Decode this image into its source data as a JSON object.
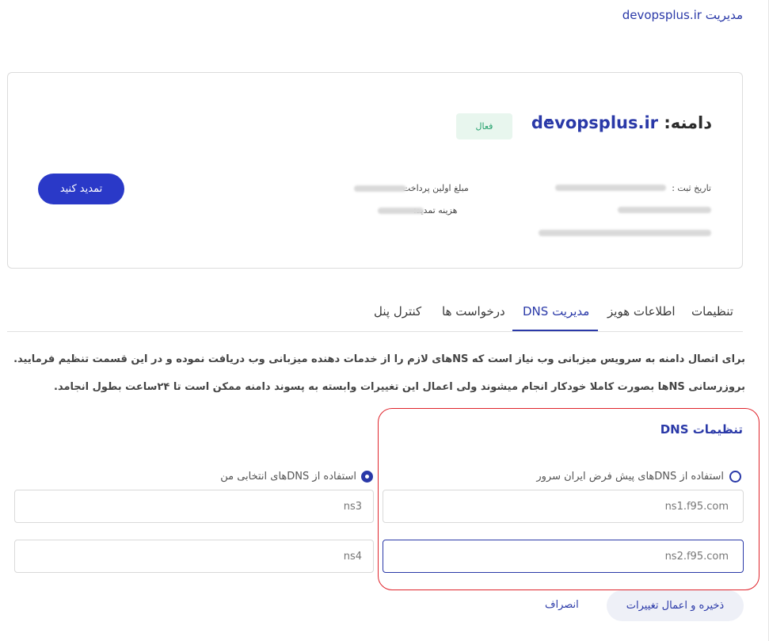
{
  "breadcrumb": {
    "prefix": "مدیریت",
    "domain": "devopsplus.ir"
  },
  "domain_card": {
    "label": "دامنه:",
    "name": "devopsplus.ir",
    "status": "فعال",
    "renew_button": "تمدید کنید",
    "register_date_label": "تاریخ ثبت :",
    "first_payment_label": "مبلغ اولین پرداخت",
    "renewal_cost_label": "هزینه تمدید:"
  },
  "tabs": [
    {
      "label": "تنظیمات"
    },
    {
      "label": "اطلاعات هویز"
    },
    {
      "label": "مدیریت DNS"
    },
    {
      "label": "درخواست ها"
    },
    {
      "label": "کنترل پنل"
    }
  ],
  "description": "برای اتصال دامنه به سرویس میزبانی وب نیاز است که NSهای لازم را از خدمات دهنده میزبانی وب دریافت نموده و در این قسمت تنظیم فرمایید. بروزرسانی NSها بصورت کاملا خودکار انجام میشوند ولی اعمال این تغییرات وابسته به پسوند دامنه ممکن است تا ۲۴ساعت بطول انجامد.",
  "dns_settings": {
    "title": "تنظیمات DNS",
    "option_default": "استفاده از DNSهای پیش فرض ایران سرور",
    "option_custom": "استفاده از DNSهای انتخابی من",
    "ns1": "ns1.f95.com",
    "ns2": "ns2.f95.com",
    "ns3_placeholder": "ns3",
    "ns4_placeholder": "ns4"
  },
  "actions": {
    "save": "ذخیره و اعمال تغییرات",
    "cancel": "انصراف"
  },
  "colors": {
    "accent": "#2a39a8",
    "button": "#2a39c8",
    "status_green": "#22a06b",
    "highlight_border": "#e0242c"
  }
}
